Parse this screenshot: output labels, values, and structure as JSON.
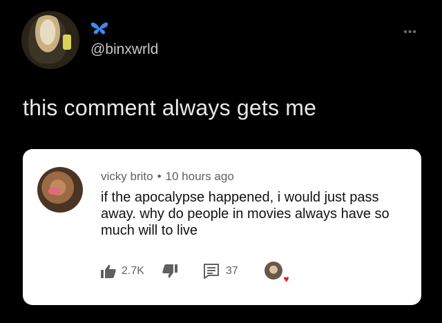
{
  "tweet": {
    "handle": "@binxwrld",
    "text": "this comment always gets me",
    "icons": {
      "avatar": "profile-photo",
      "badge": "butterfly-icon",
      "more": "more-dots-icon"
    }
  },
  "comment_card": {
    "author": "vicky brito",
    "separator": "•",
    "time": "10 hours ago",
    "text": "if the apocalypse happened, i would just pass away. why do people in movies always have so much will to live",
    "likes": "2.7K",
    "replies": "37",
    "icons": {
      "like": "thumbs-up-icon",
      "dislike": "thumbs-down-icon",
      "reply": "comment-icon",
      "creator_heart": "heart-icon"
    }
  },
  "colors": {
    "background": "#000000",
    "card": "#ffffff",
    "handle_text": "#c8c8c8",
    "heart": "#e01f2a",
    "butterfly": "#3b8cf0"
  }
}
